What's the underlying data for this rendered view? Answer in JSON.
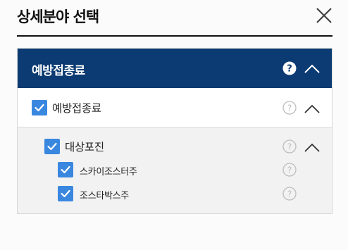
{
  "header": {
    "title": "상세분야 선택",
    "close_icon": "close-icon"
  },
  "panel": {
    "category": {
      "label": "예방접종료",
      "help_icon": "question-circle-icon",
      "toggle_icon": "chevron-up-icon",
      "expanded": true
    },
    "group": {
      "label": "예방접종료",
      "checked": true,
      "expanded": true
    },
    "subgroup": {
      "label": "대상포진",
      "checked": true,
      "expanded": true,
      "items": [
        {
          "label": "스카이조스터주",
          "checked": true
        },
        {
          "label": "조스타박스주",
          "checked": true
        }
      ]
    }
  },
  "colors": {
    "header_bar": "#0b3b72",
    "checkbox": "#3a87e0",
    "sub_bg": "#f2f2f2",
    "help_gray": "#bdbdbd"
  }
}
